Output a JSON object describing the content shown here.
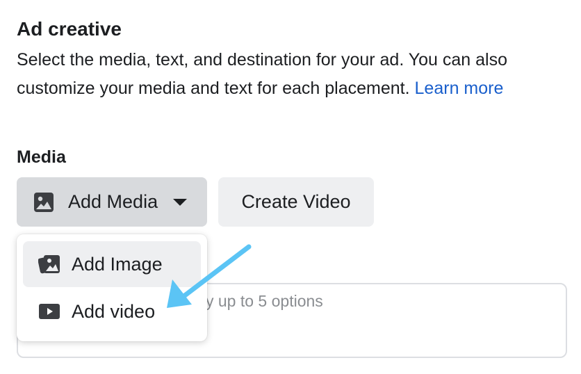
{
  "section": {
    "title": "Ad creative",
    "description_line1": "Select the media, text, and destination for your ad. You can also",
    "description_line2": "customize your media and text for each placement.",
    "learn_more": "Learn more"
  },
  "media": {
    "label": "Media",
    "add_media_label": "Add Media",
    "add_media_icon": "image-icon",
    "create_video_label": "Create Video"
  },
  "dropdown": {
    "items": [
      {
        "label": "Add Image",
        "icon": "images-icon"
      },
      {
        "label": "Add video",
        "icon": "video-play-icon"
      }
    ]
  },
  "primary_text": {
    "placeholder_visible": "y up to 5 options"
  },
  "annotation": {
    "arrow_color": "#5bc4f5"
  },
  "colors": {
    "link": "#1a5fcc",
    "button_gray": "#d8dadd",
    "button_light": "#eeeff1"
  }
}
